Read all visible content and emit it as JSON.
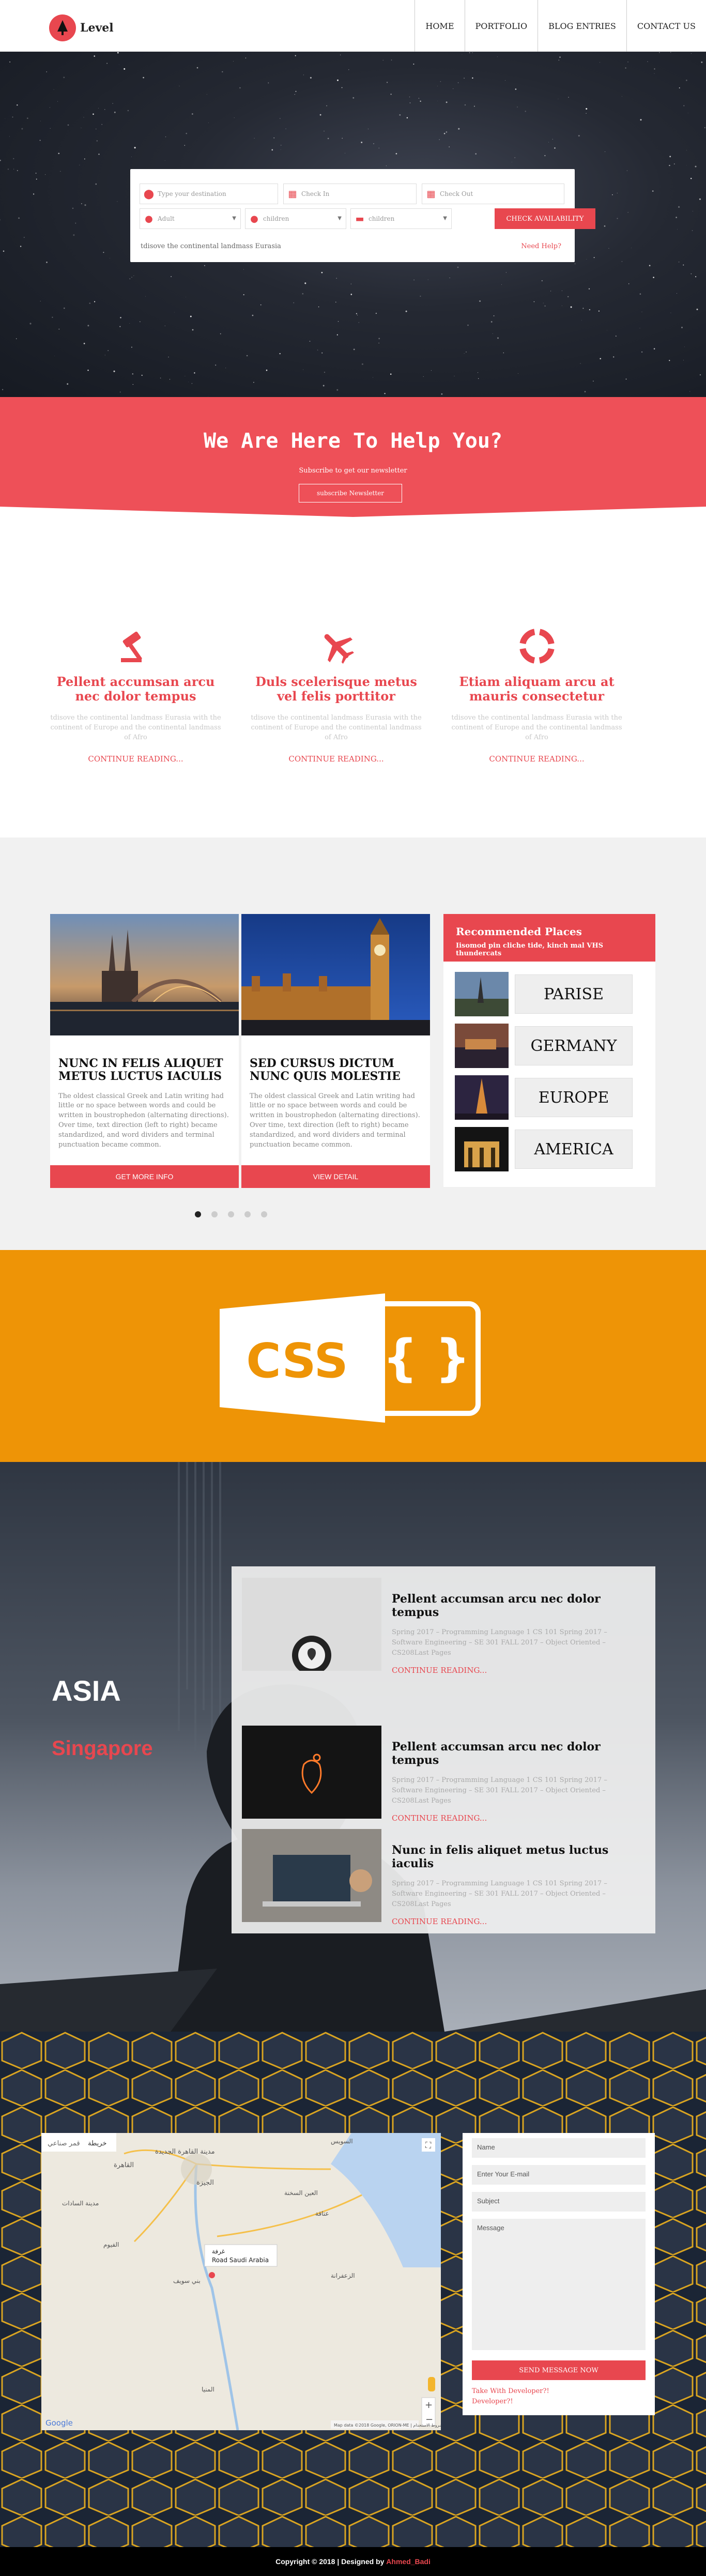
{
  "header": {
    "brand": "Level",
    "nav": [
      "HOME",
      "PORTFOLIO",
      "BLOG ENTRIES",
      "CONTACT US"
    ]
  },
  "hero": {
    "destination_placeholder": "Type your destination",
    "checkin_placeholder": "Check In",
    "checkout_placeholder": "Check Out",
    "adult_value": "Adult",
    "children1_value": "children",
    "children2_value": "children",
    "check_button": "CHECK AVAILABILITY",
    "note": "tdisove the continental landmass Eurasia",
    "need_help": "Need Help?"
  },
  "help": {
    "title": "We Are Here To Help You?",
    "subtitle": "Subscribe to get our newsletter",
    "button": "subscribe Newsletter"
  },
  "features": [
    {
      "icon": "gavel-icon",
      "title": "Pellent accumsan arcu nec dolor tempus",
      "text": "tdisove the continental landmass Eurasia with the continent of Europe and the continental landmass of Afro",
      "link": "CONTINUE READING..."
    },
    {
      "icon": "airplane-icon",
      "title": "Duls scelerisque metus vel felis porttitor",
      "text": "tdisove the continental landmass Eurasia with the continent of Europe and the continental landmass of Afro",
      "link": "CONTINUE READING..."
    },
    {
      "icon": "lifebuoy-icon",
      "title": "Etiam aliquam arcu at mauris consectetur",
      "text": "tdisove the continental landmass Eurasia with the continent of Europe and the continental landmass of Afro",
      "link": "CONTINUE READING..."
    }
  ],
  "cards": [
    {
      "title": "NUNC IN FELIS ALIQUET METUS LUCTUS IACULIS",
      "text": "The oldest classical Greek and Latin writing had little or no space between words and could be written in boustrophedon (alternating directions). Over time, text direction (left to right) became standardized, and word dividers and terminal punctuation became common.",
      "button": "GET MORE INFO"
    },
    {
      "title": "SED CURSUS DICTUM NUNC QUIS MOLESTIE",
      "text": "The oldest classical Greek and Latin writing had little or no space between words and could be written in boustrophedon (alternating directions). Over time, text direction (left to right) became standardized, and word dividers and terminal punctuation became common.",
      "button": "VIEW DETAIL"
    }
  ],
  "recommended": {
    "title": "Recommended Places",
    "subtitle": "Iisomod pin cliche tide, kinch mal VHS thundercats",
    "places": [
      "PARISE",
      "GERMANY",
      "EUROPE",
      "AMERICA"
    ]
  },
  "css_banner": {
    "label": "CSS",
    "braces": "{ }"
  },
  "asia": {
    "region": "ASIA",
    "city": "Singapore",
    "posts": [
      {
        "title": "Pellent accumsan arcu nec dolor tempus",
        "text": "Spring 2017 – Programming Language 1 CS 101 Spring 2017 – Software Engineering – SE 301 FALL 2017 – Object Oriented – CS208Last Pages",
        "link": "CONTINUE READING..."
      },
      {
        "title": "Pellent accumsan arcu nec dolor tempus",
        "text": "Spring 2017 – Programming Language 1 CS 101 Spring 2017 – Software Engineering – SE 301 FALL 2017 – Object Oriented – CS208Last Pages",
        "link": "CONTINUE READING..."
      },
      {
        "title": "Nunc in felis aliquet metus luctus iaculis",
        "text": "Spring 2017 – Programming Language 1 CS 101 Spring 2017 – Software Engineering – SE 301 FALL 2017 – Object Oriented – CS208Last Pages",
        "link": "CONTINUE READING..."
      }
    ]
  },
  "map": {
    "map_tab": "خريطة",
    "satellite_tab": "قمر صناعي",
    "city_labels": [
      "القاهرة",
      "الجيزة",
      "مدينة القاهرة الجديدة",
      "العين السخنة",
      "مدينة السادات",
      "الفيوم",
      "بني سويف",
      "عتاقة",
      "السويس",
      "الزعفرانة",
      "المنيا"
    ],
    "marker_title": "غرفة",
    "marker_label": "Road Saudi Arabia",
    "attribution": "Map data ©2018 Google, ORION-ME | شروط الاستخدام",
    "google": "Google",
    "zoom_in": "+",
    "zoom_out": "−"
  },
  "contact": {
    "name_placeholder": "Name",
    "email_placeholder": "Enter Your E-mail",
    "subject_placeholder": "Subject",
    "message_placeholder": "Message",
    "send_button": "SEND MESSAGE NOW",
    "take_with": "Take With Developer?!",
    "developer": "Developer?!"
  },
  "footer": {
    "copyright": "Copyright © 2018 | Designed by",
    "author": "Ahmed_Badi"
  },
  "colors": {
    "accent": "#e8474f",
    "orange": "#ee9406"
  }
}
